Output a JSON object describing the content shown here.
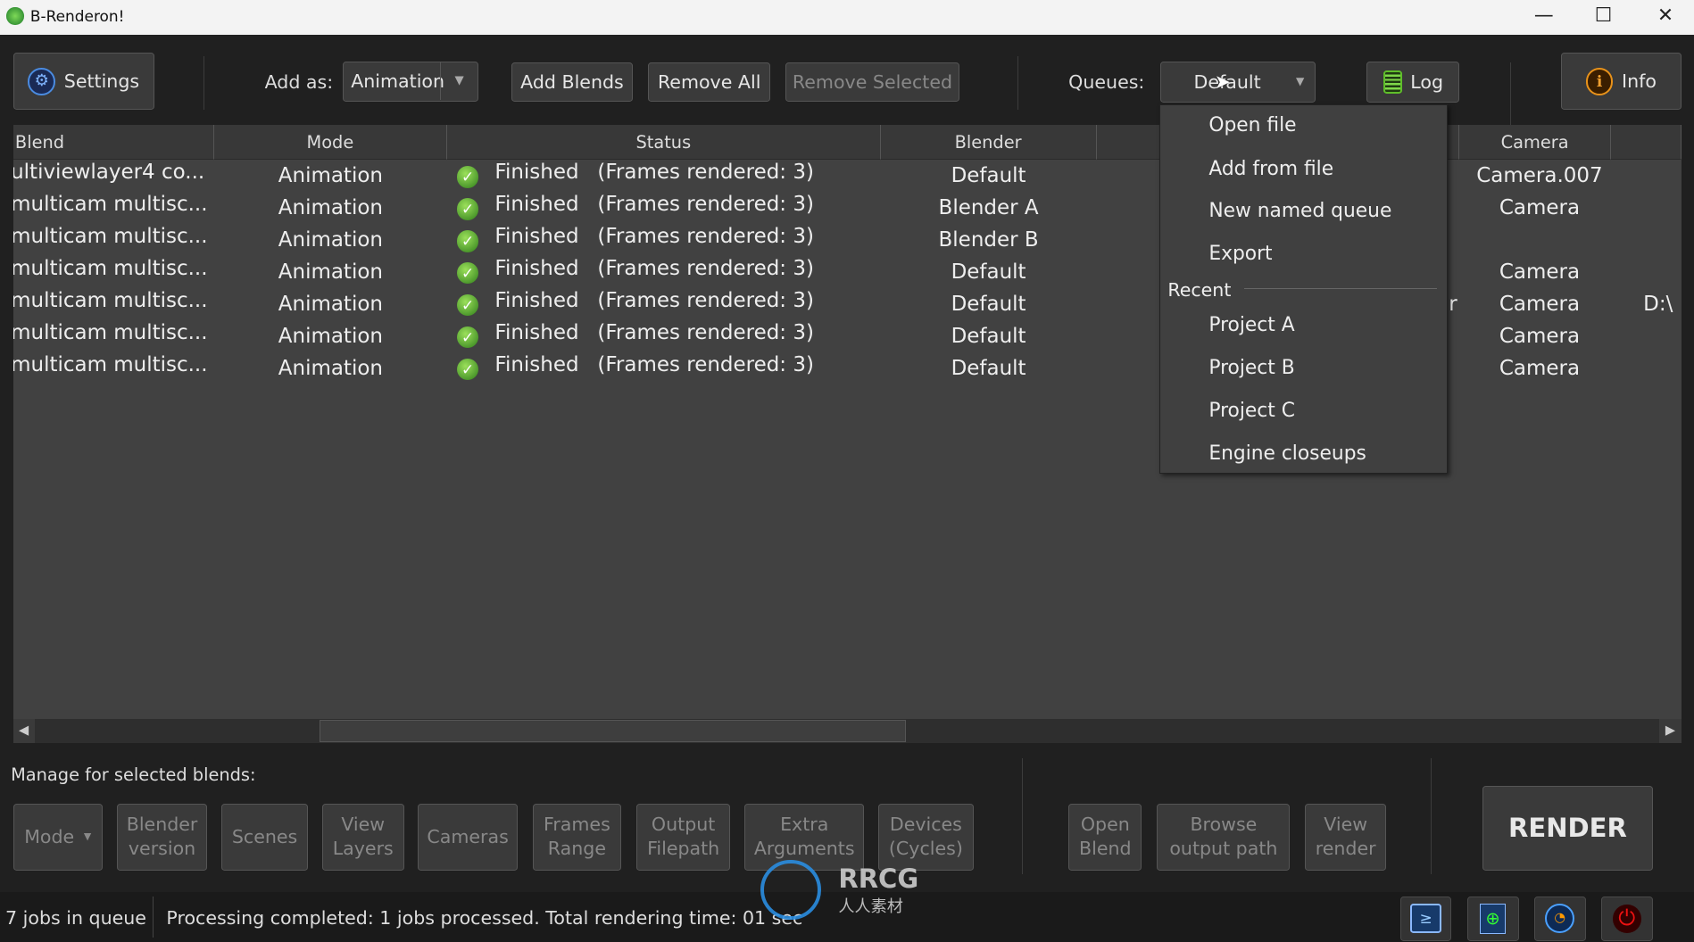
{
  "window": {
    "title": "B-Renderon!",
    "minimize": "—",
    "maximize": "☐",
    "close": "✕"
  },
  "toolbar": {
    "settings": "Settings",
    "add_as_label": "Add as:",
    "add_as_value": "Animation",
    "add_blends": "Add Blends",
    "remove_all": "Remove All",
    "remove_selected": "Remove Selected",
    "queues_label": "Queues:",
    "queue_value": "Default",
    "log": "Log",
    "info": "Info"
  },
  "table": {
    "headers": [
      "Blend",
      "Mode",
      "Status",
      "Blender",
      "",
      "Camera",
      ""
    ],
    "rows": [
      {
        "blend": "ultiviewlayer4 co...",
        "mode": "Animation",
        "status": "Finished",
        "frames": "(Frames rendered: 3)",
        "blender": "Default",
        "hidden": "",
        "camera": "Camera.007",
        "extra": ""
      },
      {
        "blend": "multicam multisc...",
        "mode": "Animation",
        "status": "Finished",
        "frames": "(Frames rendered: 3)",
        "blender": "Blender A",
        "hidden": "",
        "camera": "Camera",
        "extra": ""
      },
      {
        "blend": "multicam multisc...",
        "mode": "Animation",
        "status": "Finished",
        "frames": "(Frames rendered: 3)",
        "blender": "Blender B",
        "hidden": "",
        "camera": "",
        "extra": ""
      },
      {
        "blend": "multicam multisc...",
        "mode": "Animation",
        "status": "Finished",
        "frames": "(Frames rendered: 3)",
        "blender": "Default",
        "hidden": "",
        "camera": "Camera",
        "extra": ""
      },
      {
        "blend": "multicam multisc...",
        "mode": "Animation",
        "status": "Finished",
        "frames": "(Frames rendered: 3)",
        "blender": "Default",
        "hidden": "r",
        "camera": "Camera",
        "extra": "D:\\"
      },
      {
        "blend": "multicam multisc...",
        "mode": "Animation",
        "status": "Finished",
        "frames": "(Frames rendered: 3)",
        "blender": "Default",
        "hidden": "",
        "camera": "Camera",
        "extra": ""
      },
      {
        "blend": "multicam multisc...",
        "mode": "Animation",
        "status": "Finished",
        "frames": "(Frames rendered: 3)",
        "blender": "Default",
        "hidden": "",
        "camera": "Camera",
        "extra": ""
      }
    ]
  },
  "queue_menu": {
    "items": [
      "Open file",
      "Add from file",
      "New named queue",
      "Export"
    ],
    "recent_label": "Recent",
    "recent": [
      "Project A",
      "Project B",
      "Project C",
      "Engine closeups"
    ]
  },
  "manage": {
    "label": "Manage for selected blends:",
    "buttons": [
      "Mode",
      "Blender\nversion",
      "Scenes",
      "View\nLayers",
      "Cameras",
      "Frames\nRange",
      "Output\nFilepath",
      "Extra\nArguments",
      "Devices\n(Cycles)"
    ],
    "open_blend": "Open\nBlend",
    "browse_output": "Browse\noutput path",
    "view_render": "View\nrender",
    "render": "RENDER"
  },
  "status": {
    "jobs": "7 jobs in queue",
    "message": "Processing completed: 1 jobs processed. Total rendering time: 01 sec"
  },
  "watermark": {
    "text": "RRCG",
    "sub": "人人素材"
  }
}
